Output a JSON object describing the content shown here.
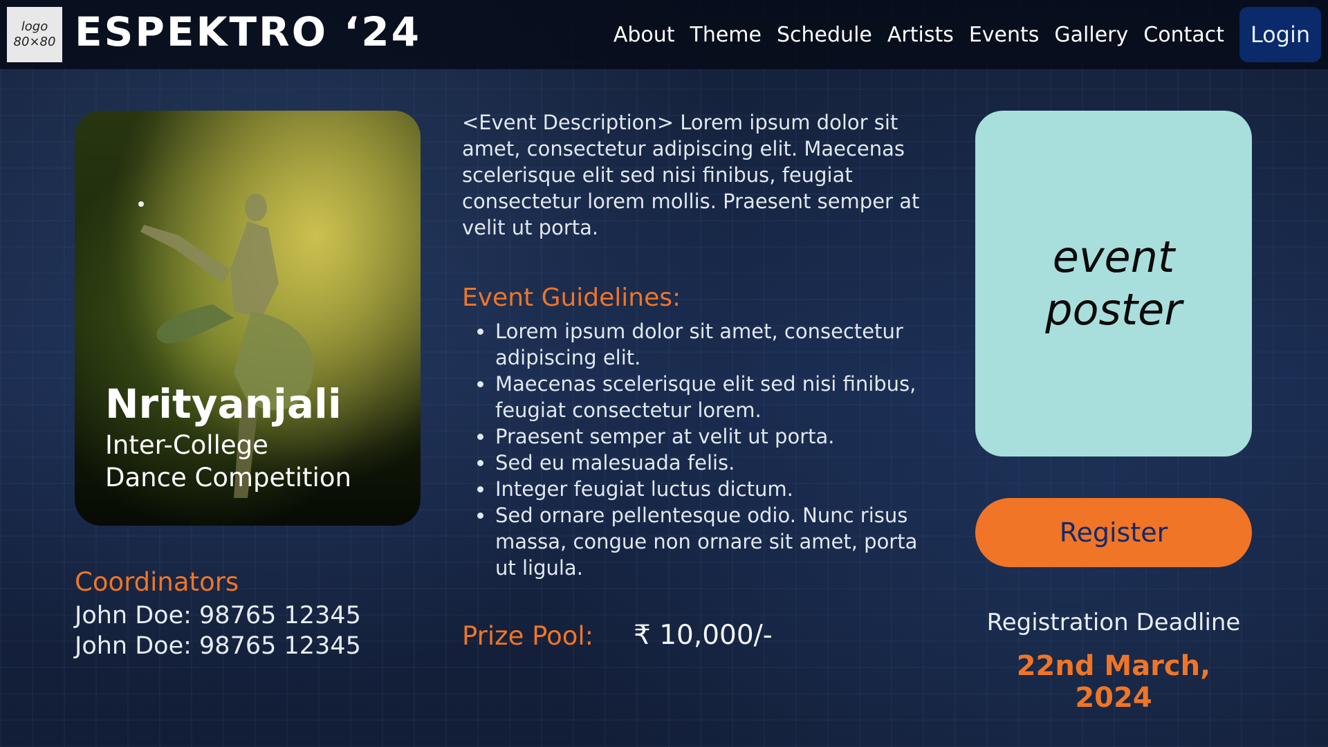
{
  "header": {
    "logo_text": "logo\n80×80",
    "brand": "ESPEKTRO ‘24",
    "nav": [
      "About",
      "Theme",
      "Schedule",
      "Artists",
      "Events",
      "Gallery",
      "Contact"
    ],
    "login_label": "Login"
  },
  "event": {
    "name": "Nrityanjali",
    "subtitle_line1": "Inter-College",
    "subtitle_line2": "Dance Competition",
    "description": "<Event Description> Lorem ipsum dolor sit amet, consectetur adipiscing elit. Maecenas scelerisque elit sed nisi finibus, feugiat consectetur lorem mollis. Praesent semper at velit ut porta.",
    "guidelines_title": "Event Guidelines:",
    "guidelines": [
      "Lorem ipsum dolor sit amet, consectetur adipiscing elit.",
      "Maecenas scelerisque elit sed nisi finibus, feugiat consectetur lorem.",
      "Praesent semper at velit ut porta.",
      "Sed eu malesuada felis.",
      "Integer feugiat luctus dictum.",
      "Sed ornare pellentesque odio. Nunc risus massa, congue non ornare sit amet, porta ut ligula."
    ],
    "prize_label": "Prize Pool:",
    "prize_value": "₹ 10,000/-"
  },
  "coordinators": {
    "title": "Coordinators",
    "items": [
      "John Doe: 98765 12345",
      "John Doe: 98765 12345"
    ]
  },
  "poster": {
    "placeholder": "event\nposter"
  },
  "register": {
    "label": "Register"
  },
  "deadline": {
    "label": "Registration Deadline",
    "date": "22nd March, 2024"
  },
  "colors": {
    "accent_orange": "#f07526",
    "poster_bg": "#a8dedc",
    "login_bg": "#0b2a6b",
    "background": "#18284a"
  }
}
